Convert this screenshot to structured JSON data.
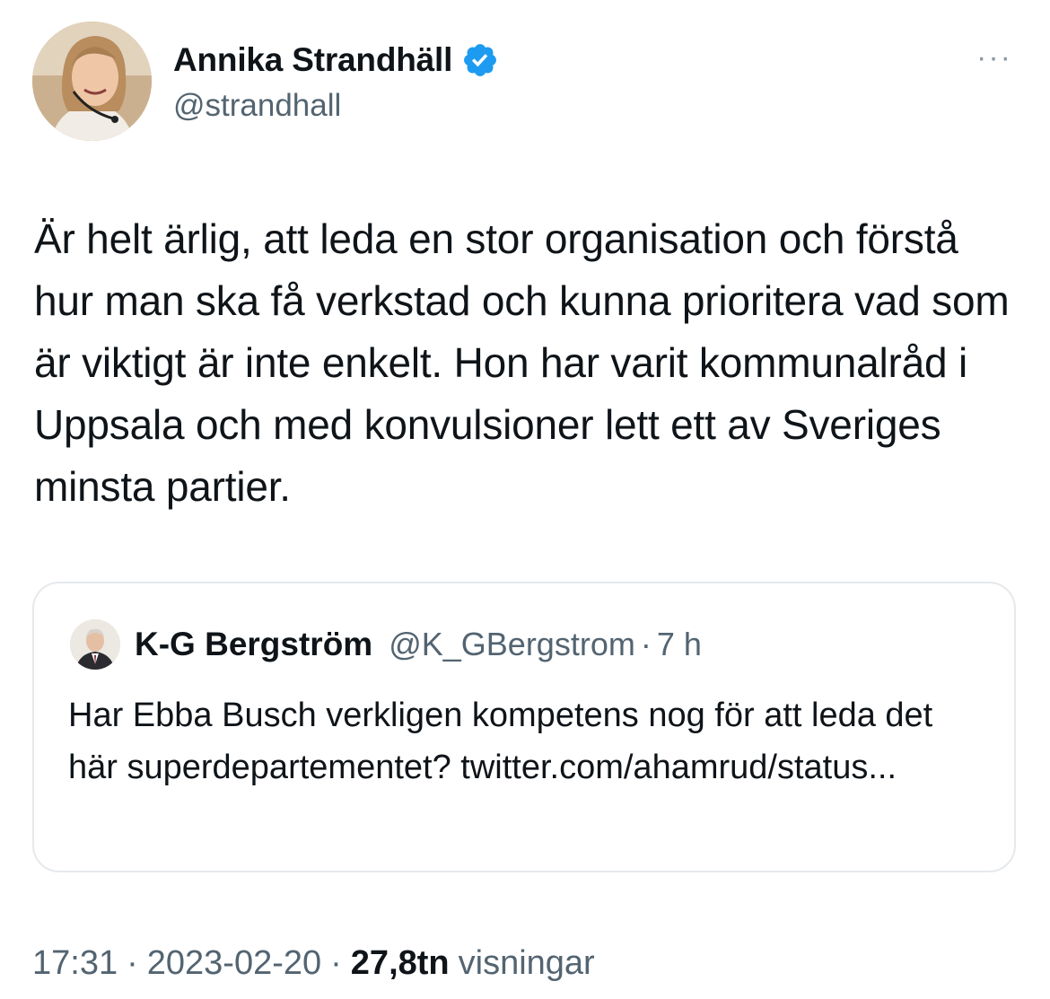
{
  "author": {
    "display_name": "Annika Strandhäll",
    "handle": "@strandhall",
    "verified": true
  },
  "icons": {
    "more": "more-horizontal-icon",
    "verified": "verified-badge-icon"
  },
  "more_label": "···",
  "tweet": {
    "text": "Är helt ärlig, att leda en stor organisation och förstå hur man ska få verkstad och kunna prioritera vad som är viktigt är inte enkelt. Hon har varit kommunalråd i Uppsala och med konvulsioner lett ett av Sveriges minsta partier."
  },
  "quote": {
    "display_name": "K-G Bergström",
    "handle": "@K_GBergstrom",
    "separator": "·",
    "time": "7 h",
    "text": "Har Ebba Busch verkligen kompetens nog för att leda det här superdepartementet? twitter.com/ahamrud/status..."
  },
  "meta": {
    "time": "17:31",
    "separator": "·",
    "date": "2023-02-20",
    "views_count": "27,8tn",
    "views_label": "visningar"
  },
  "colors": {
    "verified_blue": "#1d9bf0",
    "secondary_text": "#536471",
    "primary_text": "#0f1419",
    "border": "#e6e9ec"
  }
}
